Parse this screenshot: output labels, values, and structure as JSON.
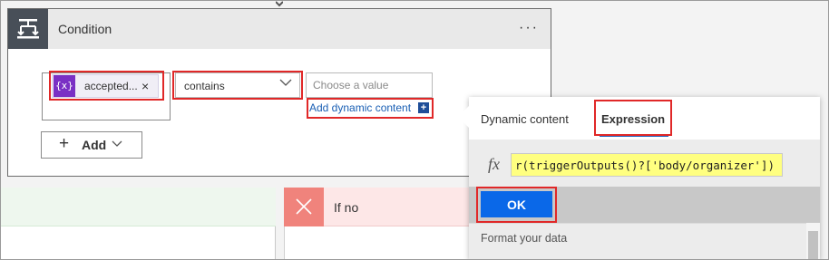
{
  "condition": {
    "title": "Condition",
    "more_label": "···",
    "token": {
      "icon_text": "{x}",
      "label": "accepted...",
      "remove_label": "×"
    },
    "operator": {
      "label": "contains"
    },
    "value": {
      "placeholder": "Choose a value"
    },
    "add_dynamic_label": "Add dynamic content",
    "add_dynamic_plus": "+",
    "add_button": {
      "plus": "+",
      "label": "Add"
    }
  },
  "branches": {
    "no_label": "If no"
  },
  "panel": {
    "tabs": [
      {
        "label": "Dynamic content",
        "active": false
      },
      {
        "label": "Expression",
        "active": true
      }
    ],
    "fx_label": "fx",
    "expression_value": "r(triggerOutputs()?['body/organizer'])",
    "ok_label": "OK",
    "format_label": "Format your data"
  },
  "colors": {
    "highlight": "#e02828",
    "token_icon": "#7a30c4",
    "ok_button": "#0a68e8",
    "link": "#1a5fb4",
    "expression_highlight": "#ffff80"
  },
  "icons": {
    "condition": "condition-icon",
    "remove": "close-icon",
    "operator_dropdown": "chevron-down-icon",
    "add_dropdown": "chevron-down-icon",
    "no_branch": "x-icon"
  }
}
